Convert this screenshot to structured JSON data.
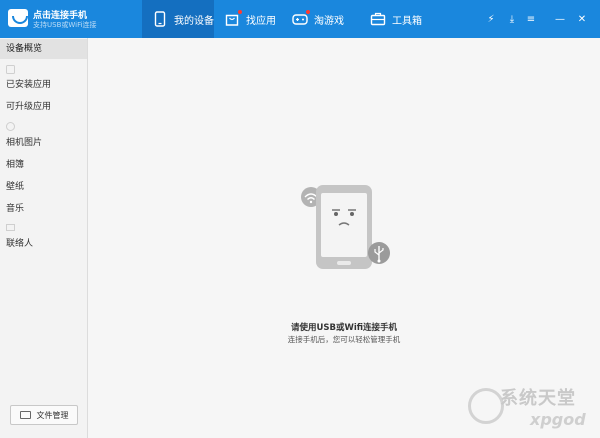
{
  "app": {
    "title": "点击连接手机",
    "subtitle": "支持USB或WiFi连接"
  },
  "nav": {
    "tabs": [
      {
        "label": "我的设备",
        "icon": "phone-icon",
        "active": true,
        "badge": false
      },
      {
        "label": "找应用",
        "icon": "shopping-bag-icon",
        "active": false,
        "badge": true
      },
      {
        "label": "淘游戏",
        "icon": "gamepad-icon",
        "active": false,
        "badge": true
      },
      {
        "label": "工具箱",
        "icon": "toolbox-icon",
        "active": false,
        "badge": false
      }
    ],
    "window_controls": [
      "flash-icon",
      "download-icon",
      "menu-icon",
      "minimize-icon",
      "close-icon"
    ],
    "window_glyphs": {
      "flash": "⚡",
      "download": "⤓",
      "menu": "≡",
      "minimize": "—",
      "close": "✕"
    }
  },
  "sidebar": {
    "items": [
      {
        "label": "设备概览",
        "active": true
      },
      {
        "label": "已安装应用",
        "active": false
      },
      {
        "label": "可升级应用",
        "active": false
      },
      {
        "label": "相机图片",
        "active": false
      },
      {
        "label": "相簿",
        "active": false
      },
      {
        "label": "壁纸",
        "active": false
      },
      {
        "label": "音乐",
        "active": false
      },
      {
        "label": "联络人",
        "active": false
      }
    ],
    "file_manager_label": "文件管理"
  },
  "main": {
    "message_title": "请使用USB或Wifi连接手机",
    "message_sub": "连接手机后，您可以轻松管理手机"
  },
  "watermark": {
    "text": "系统天堂",
    "sub": "xpgod"
  },
  "colors": {
    "topbar": "#1a87dd",
    "topbar_active": "#146fc0",
    "badge": "#ff3b30",
    "sidebar_bg": "#f3f3f3",
    "main_bg": "#f6f6f6"
  }
}
